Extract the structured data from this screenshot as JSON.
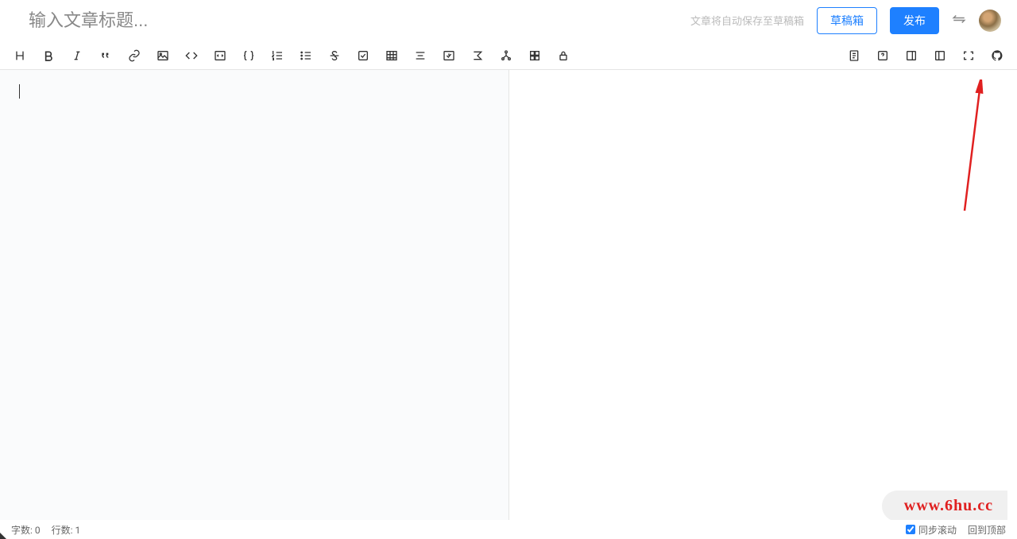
{
  "header": {
    "title_placeholder": "输入文章标题...",
    "autosave_text": "文章将自动保存至草稿箱",
    "drafts_label": "草稿箱",
    "publish_label": "发布"
  },
  "toolbar": {
    "left_icons": [
      {
        "name": "heading-icon"
      },
      {
        "name": "bold-icon"
      },
      {
        "name": "italic-icon"
      },
      {
        "name": "quote-icon"
      },
      {
        "name": "link-icon"
      },
      {
        "name": "image-icon"
      },
      {
        "name": "code-icon"
      },
      {
        "name": "codeblock-icon"
      },
      {
        "name": "braces-icon"
      },
      {
        "name": "ol-icon"
      },
      {
        "name": "ul-icon"
      },
      {
        "name": "strike-icon"
      },
      {
        "name": "task-icon"
      },
      {
        "name": "table-icon"
      },
      {
        "name": "align-icon"
      },
      {
        "name": "insert-image-icon"
      },
      {
        "name": "formula-icon"
      },
      {
        "name": "diagram-icon"
      },
      {
        "name": "grid-icon"
      },
      {
        "name": "lock-icon"
      }
    ],
    "right_icons": [
      {
        "name": "doc-icon"
      },
      {
        "name": "help-icon"
      },
      {
        "name": "split-right-icon"
      },
      {
        "name": "split-left-icon"
      },
      {
        "name": "fullscreen-icon"
      },
      {
        "name": "github-icon"
      }
    ]
  },
  "footer": {
    "word_count_label": "字数: 0",
    "line_count_label": "行数: 1",
    "sync_scroll_label": "同步滚动",
    "back_to_top_label": "回到顶部"
  },
  "watermark": "www.6hu.cc"
}
